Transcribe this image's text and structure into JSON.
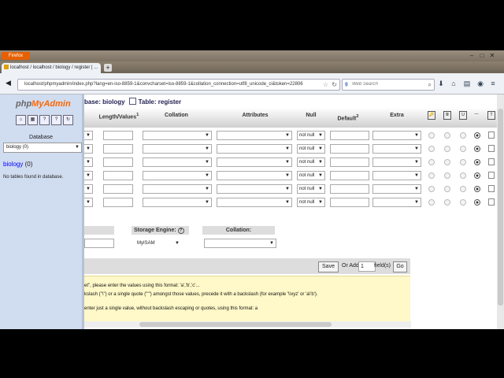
{
  "browser": {
    "menu_label": "Firefox",
    "tab_title": "localhost / localhost / biology / register | ...",
    "new_tab": "+",
    "url": "localhost/phpmyadmin/index.php?lang=en-iso-8859-1&convcharset=iso-8859-1&collation_connection=utf8_unicode_ci&token=22806",
    "search_placeholder": "Web Search",
    "search_engine_glyph": "g"
  },
  "sidebar": {
    "logo_part1": "php",
    "logo_part2": "MyAdmin",
    "database_label": "Database",
    "db_select_value": "biology (0)",
    "db_name": "biology",
    "db_count": "(0)",
    "no_tables": "No tables found in database."
  },
  "breadcrumb": {
    "prefix": "base: ",
    "db": "biology",
    "table_prefix": "Table: ",
    "table": "register"
  },
  "columns": {
    "length": "Length/Values",
    "length_sup": "1",
    "collation": "Collation",
    "attributes": "Attributes",
    "null": "Null",
    "default": "Default",
    "default_sup": "2",
    "extra": "Extra"
  },
  "rows": [
    {
      "null": "not null",
      "selected_index": 3
    },
    {
      "null": "not null",
      "selected_index": 3
    },
    {
      "null": "not null",
      "selected_index": 3
    },
    {
      "null": "not null",
      "selected_index": 3
    },
    {
      "null": "not null",
      "selected_index": 3
    },
    {
      "null": "not null",
      "selected_index": 3
    }
  ],
  "table_options": {
    "storage_engine_label": "Storage Engine:",
    "storage_engine_value": "MyISAM",
    "collation_label": "Collation:"
  },
  "actions": {
    "save": "Save",
    "or_add": "Or Add",
    "add_count": "1",
    "fields": "field(s)",
    "go": "Go"
  },
  "notes": {
    "line1": "et\", please enter the values using this format: 'a','b','c'...",
    "line2": "kslash (\"\\\") or a single quote (\"'\") amongst those values, precede it with a backslash (for example '\\\\xyz' or 'a\\'b').",
    "line3": "enter just a single value, without backslash escaping or quotes, using this format: a"
  },
  "colors": {
    "sidebar_bg": "#d0dcef",
    "note_bg": "#fff8c8",
    "firefox_orange": "#e66000"
  }
}
